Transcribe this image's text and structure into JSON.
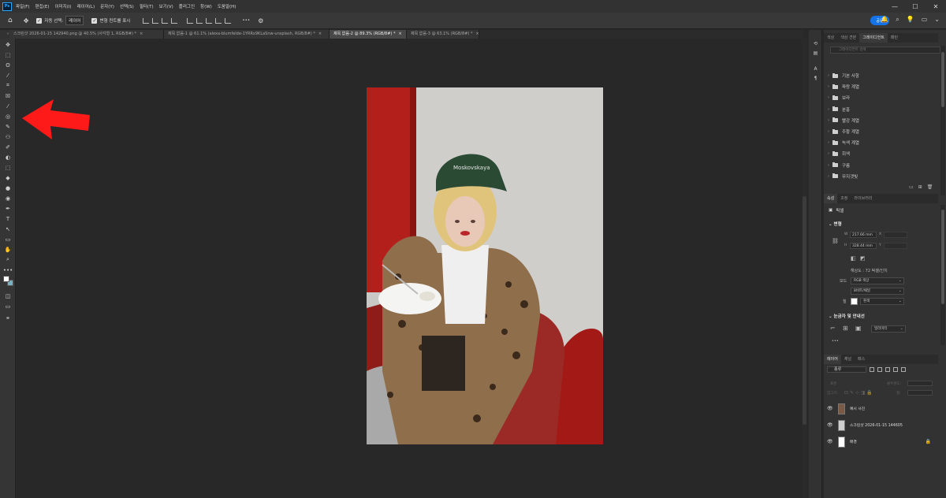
{
  "app": {
    "logo": "Ps"
  },
  "menu": [
    "파일(F)",
    "편집(E)",
    "이미지(I)",
    "레이어(L)",
    "문자(Y)",
    "선택(S)",
    "필터(T)",
    "보기(V)",
    "플러그인",
    "창(W)",
    "도움말(H)"
  ],
  "window_controls": [
    "—",
    "☐",
    "✕"
  ],
  "options": {
    "auto_select_label": "자동 선택:",
    "auto_select_value": "레이어",
    "transform_label": "변형 컨트롤 표시",
    "more": "•••",
    "share": "공유"
  },
  "tabs": [
    {
      "label": "스크린샷 2026-01-15 142940.png @ 40.5% (사각형 1, RGB/8#) *",
      "close": "×",
      "active": false
    },
    {
      "label": "제목 없음-1 @ 61.1% (alexa-blumfelde-1YRRx9KLaSnw-unsplash, RGB/8#) *",
      "close": "×",
      "active": false
    },
    {
      "label": "제목 없음-2 @ 89.3% (RGB/8#) *",
      "close": "×",
      "active": true
    },
    {
      "label": "제목 없음-3 @ 63.1% (RGB/8#) *",
      "close": "×",
      "active": false
    }
  ],
  "tools": [
    "✥",
    "⬚",
    "ʘ",
    "⁄",
    "⌗",
    "☒",
    "⁄",
    "◎",
    "✎",
    "⚇",
    "✐",
    "◐",
    "⬚",
    "◆",
    "●",
    "◉",
    "✒",
    "T",
    "↖",
    "▭",
    "✋",
    "⌕",
    "•••"
  ],
  "canvas": {
    "cap_text": "Moskovskaya"
  },
  "right_panel": {
    "top_tabs": [
      "색상",
      "색상 견본",
      "그레이디언트",
      "패턴"
    ],
    "search_placeholder": "그레이디언트 검색",
    "gradient_folders": [
      "기본 사항",
      "파랑 계열",
      "보라",
      "분홍",
      "빨강 계열",
      "주황 계열",
      "녹색 계열",
      "회색",
      "구름",
      "무지갯빛"
    ],
    "props_tabs": [
      "속성",
      "조정",
      "라이브러리"
    ],
    "props_type": "픽셀",
    "transform_section": "변형",
    "w_label": "W",
    "w_value": "217.66 mm",
    "h_label": "H",
    "h_value": "328.44 mm",
    "x_label": "X",
    "y_label": "Y",
    "resolution": "해상도 : 72 픽셀/인치",
    "mode_label": "모드",
    "mode_value": "RGB 색상",
    "bits_value": "8비트/채널",
    "fill_label": "칠",
    "fill_value": "흰색",
    "guides_section": "눈금자 및 안내선",
    "units_value": "밀리미터",
    "more": "•••",
    "layers_tabs": [
      "레이어",
      "채널",
      "패스"
    ],
    "layers_filter": "종류",
    "blend_mode": "표준",
    "opacity_label": "불투명도:",
    "lock_label": "잠그기:",
    "fill_label2": "칠:",
    "layers": [
      {
        "name": "예시 사진",
        "locked": false
      },
      {
        "name": "스크린샷 2026-01-15 144605",
        "locked": false
      },
      {
        "name": "배경",
        "locked": true
      }
    ],
    "eye": "👁",
    "lock_icon": "🔒"
  },
  "colors": {
    "accent": "#1473e6",
    "arrow": "#ff1a1a",
    "background_color": "#7ab0bf"
  }
}
